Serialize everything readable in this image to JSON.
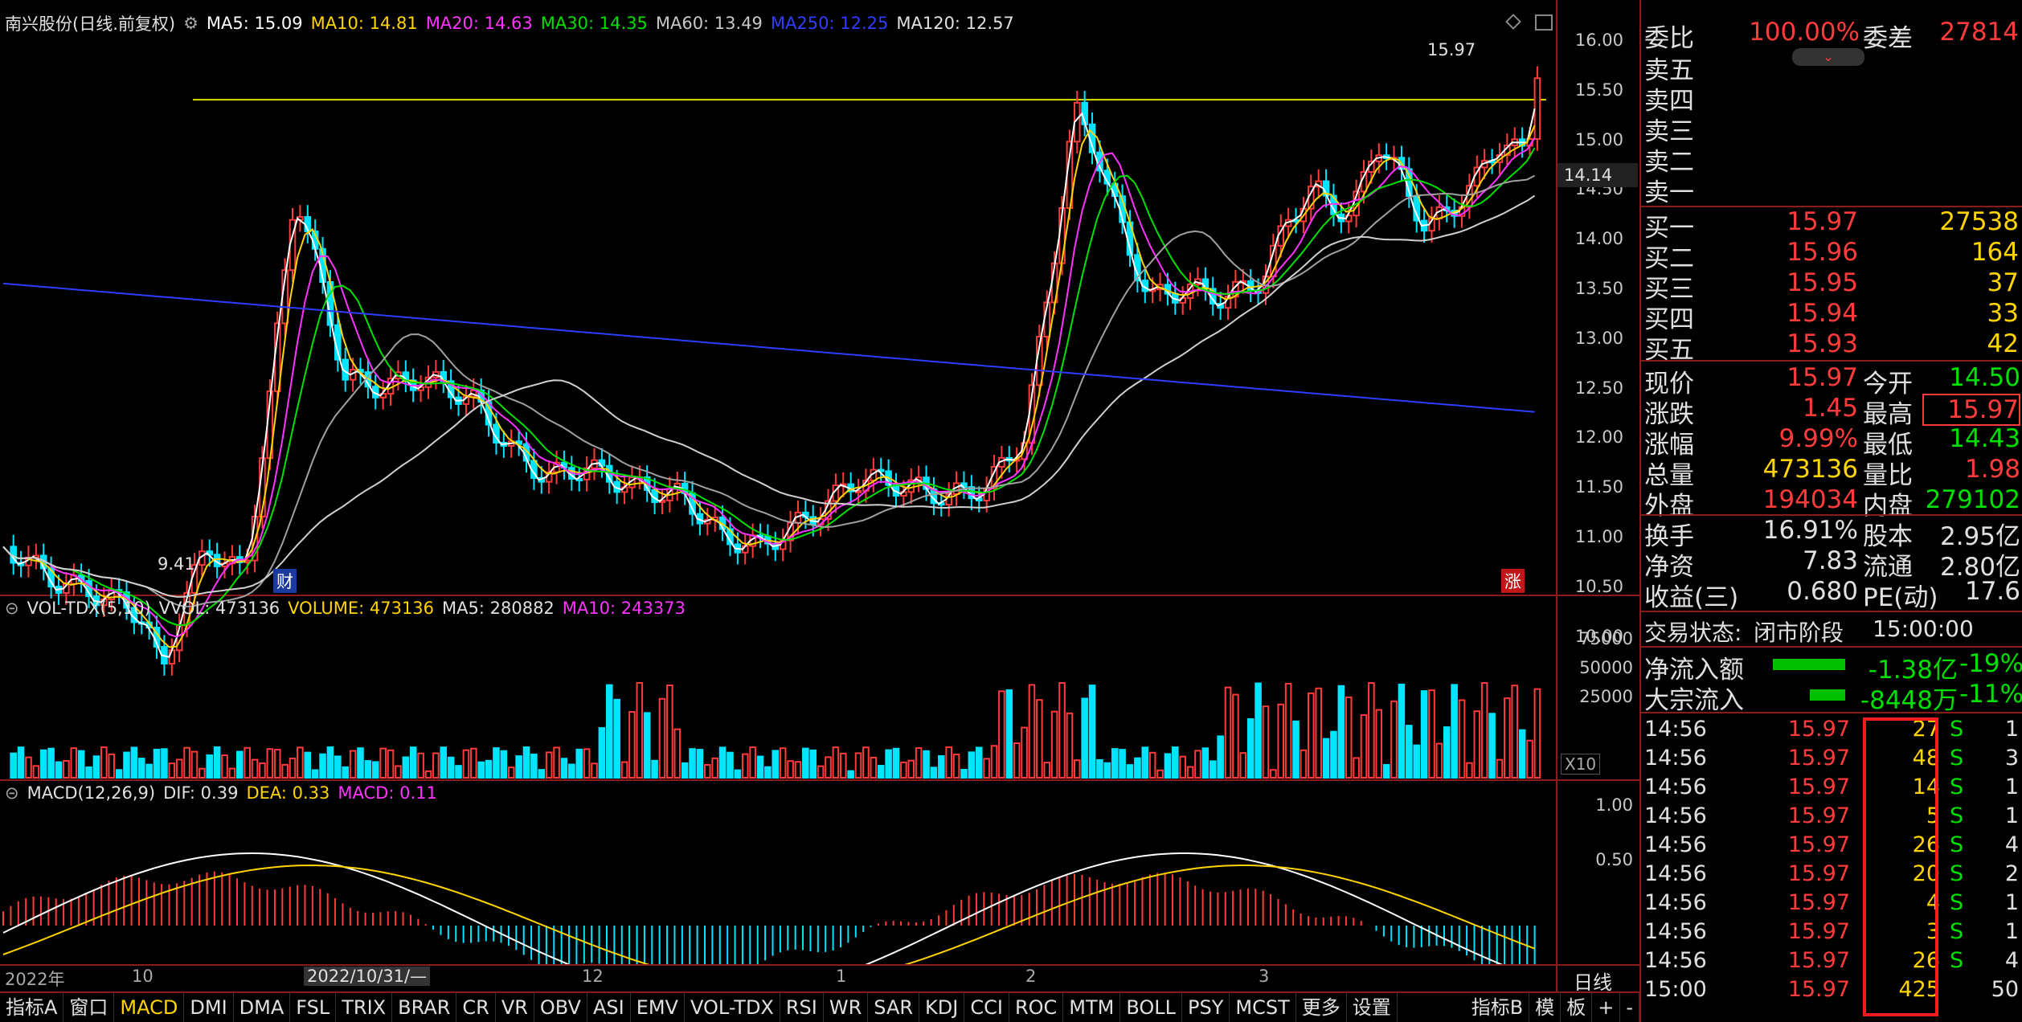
{
  "main_header": {
    "stock": "南兴股份(日线.前复权)",
    "ma5": "MA5: 15.09",
    "ma10": "MA10: 14.81",
    "ma20": "MA20: 14.63",
    "ma30": "MA30: 14.35",
    "ma60": "MA60: 13.49",
    "ma250": "MA250: 12.25",
    "ma120": "MA120: 12.57"
  },
  "price_axis": [
    "16.00",
    "15.50",
    "15.00",
    "14.50",
    "14.00",
    "13.50",
    "13.00",
    "12.50",
    "12.00",
    "11.50",
    "11.00",
    "10.50",
    "10.00"
  ],
  "current_marker": "14.14",
  "high_annotation": "15.97",
  "low_annotation": "9.41",
  "badge_cai": "财",
  "badge_zhang": "涨",
  "vol_header": {
    "name": "VOL-TDX(5,10)",
    "vvol": "VVOL: 473136",
    "volume": "VOLUME: 473136",
    "ma5": "MA5: 280882",
    "ma10": "MA10: 243373"
  },
  "vol_axis": [
    "75000",
    "50000",
    "25000"
  ],
  "vol_unit": "X10",
  "macd_header": {
    "name": "MACD(12,26,9)",
    "dif": "DIF: 0.39",
    "dea": "DEA: 0.33",
    "macd": "MACD: 0.11"
  },
  "macd_axis": [
    "1.00",
    "0.50"
  ],
  "time_axis": {
    "year": "2022年",
    "m10": "10",
    "cursor_date": "2022/10/31/—",
    "m12": "12",
    "m1": "1",
    "m2": "2",
    "m3": "3",
    "period": "日线"
  },
  "tabs": [
    "指标A",
    "窗口",
    "MACD",
    "DMI",
    "DMA",
    "FSL",
    "TRIX",
    "BRAR",
    "CR",
    "VR",
    "OBV",
    "ASI",
    "EMV",
    "VOL-TDX",
    "RSI",
    "WR",
    "SAR",
    "KDJ",
    "CCI",
    "ROC",
    "MTM",
    "BOLL",
    "PSY",
    "MCST",
    "更多",
    "设置"
  ],
  "tabs_right": [
    "指标B",
    "模",
    "板",
    "+",
    "-"
  ],
  "quote": {
    "weibi_label": "委比",
    "weibi": "100.00%",
    "weicha_label": "委差",
    "weicha": "27814",
    "sell": [
      {
        "label": "卖五"
      },
      {
        "label": "卖四"
      },
      {
        "label": "卖三"
      },
      {
        "label": "卖二"
      },
      {
        "label": "卖一"
      }
    ],
    "buy": [
      {
        "label": "买一",
        "price": "15.97",
        "vol": "27538"
      },
      {
        "label": "买二",
        "price": "15.96",
        "vol": "164"
      },
      {
        "label": "买三",
        "price": "15.95",
        "vol": "37"
      },
      {
        "label": "买四",
        "price": "15.94",
        "vol": "33"
      },
      {
        "label": "买五",
        "price": "15.93",
        "vol": "42"
      }
    ],
    "stats": [
      {
        "l1": "现价",
        "v1": "15.97",
        "l2": "今开",
        "v2": "14.50"
      },
      {
        "l1": "涨跌",
        "v1": "1.45",
        "l2": "最高",
        "v2": "15.97"
      },
      {
        "l1": "涨幅",
        "v1": "9.99%",
        "l2": "最低",
        "v2": "14.43"
      },
      {
        "l1": "总量",
        "v1": "473136",
        "l2": "量比",
        "v2": "1.98"
      },
      {
        "l1": "外盘",
        "v1": "194034",
        "l2": "内盘",
        "v2": "279102"
      }
    ],
    "stats2": [
      {
        "l1": "换手",
        "v1": "16.91%",
        "l2": "股本",
        "v2": "2.95亿"
      },
      {
        "l1": "净资",
        "v1": "7.83",
        "l2": "流通",
        "v2": "2.80亿"
      },
      {
        "l1": "收益(三)",
        "v1": "0.680",
        "l2": "PE(动)",
        "v2": "17.6"
      }
    ],
    "trade_status_label": "交易状态:",
    "trade_status": "闭市阶段",
    "trade_time": "15:00:00",
    "netflow_label": "净流入额",
    "netflow": "-1.38亿",
    "netflow_pct": "-19%",
    "block_label": "大宗流入",
    "block": "-8448万",
    "block_pct": "-11%"
  },
  "ticks": [
    {
      "t": "14:56",
      "p": "15.97",
      "v": "27",
      "s": "S",
      "n": "1"
    },
    {
      "t": "14:56",
      "p": "15.97",
      "v": "48",
      "s": "S",
      "n": "3"
    },
    {
      "t": "14:56",
      "p": "15.97",
      "v": "14",
      "s": "S",
      "n": "1"
    },
    {
      "t": "14:56",
      "p": "15.97",
      "v": "5",
      "s": "S",
      "n": "1"
    },
    {
      "t": "14:56",
      "p": "15.97",
      "v": "26",
      "s": "S",
      "n": "4"
    },
    {
      "t": "14:56",
      "p": "15.97",
      "v": "20",
      "s": "S",
      "n": "2"
    },
    {
      "t": "14:56",
      "p": "15.97",
      "v": "4",
      "s": "S",
      "n": "1"
    },
    {
      "t": "14:56",
      "p": "15.97",
      "v": "3",
      "s": "S",
      "n": "1"
    },
    {
      "t": "14:56",
      "p": "15.97",
      "v": "26",
      "s": "S",
      "n": "4"
    },
    {
      "t": "15:00",
      "p": "15.97",
      "v": "425",
      "s": "",
      "n": "50"
    }
  ],
  "colors": {
    "up": "#ff3b3b",
    "down": "#00e5ff",
    "ma5": "#ffffff",
    "ma10": "#ffd400",
    "ma20": "#ff33ff",
    "ma30": "#00e000",
    "ma250": "#2f3dff",
    "ma120": "#d0d0d0",
    "ma60": "#a0a0a0"
  }
}
